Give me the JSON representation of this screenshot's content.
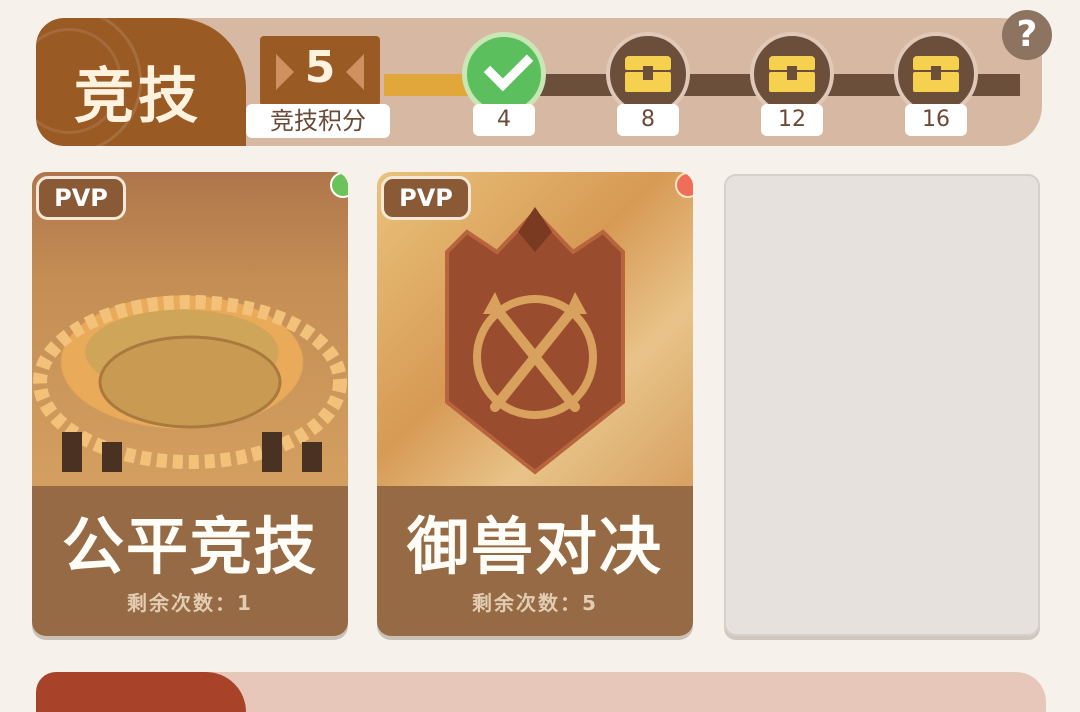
{
  "header": {
    "title": "竞技",
    "score_value": "5",
    "score_label": "竞技积分",
    "progress_fraction": 0.16,
    "milestones": [
      {
        "label": "4",
        "state": "claimed",
        "icon": "check-icon"
      },
      {
        "label": "8",
        "state": "locked",
        "icon": "chest-icon"
      },
      {
        "label": "12",
        "state": "locked",
        "icon": "chest-icon"
      },
      {
        "label": "16",
        "state": "locked",
        "icon": "chest-icon"
      }
    ],
    "help_label": "?"
  },
  "cards": [
    {
      "tag": "PVP",
      "title": "公平竞技",
      "remaining": "剩余次数：1",
      "status_dot": "green",
      "art": "arena-illustration"
    },
    {
      "tag": "PVP",
      "title": "御兽对决",
      "remaining": "剩余次数：5",
      "status_dot": "red",
      "art": "crossed-spears-shield-illustration"
    },
    {
      "empty": true
    }
  ],
  "colors": {
    "header_bg": "#d7b8a3",
    "header_tab": "#9a5a24",
    "progress_fill": "#e2a73a",
    "progress_track": "#6c4f3a",
    "claimed_green": "#5bbf5e",
    "chest_gold": "#f6d04f",
    "card_bottom": "#956a44",
    "dot_green": "#6cc35c",
    "dot_red": "#f06d5a"
  }
}
